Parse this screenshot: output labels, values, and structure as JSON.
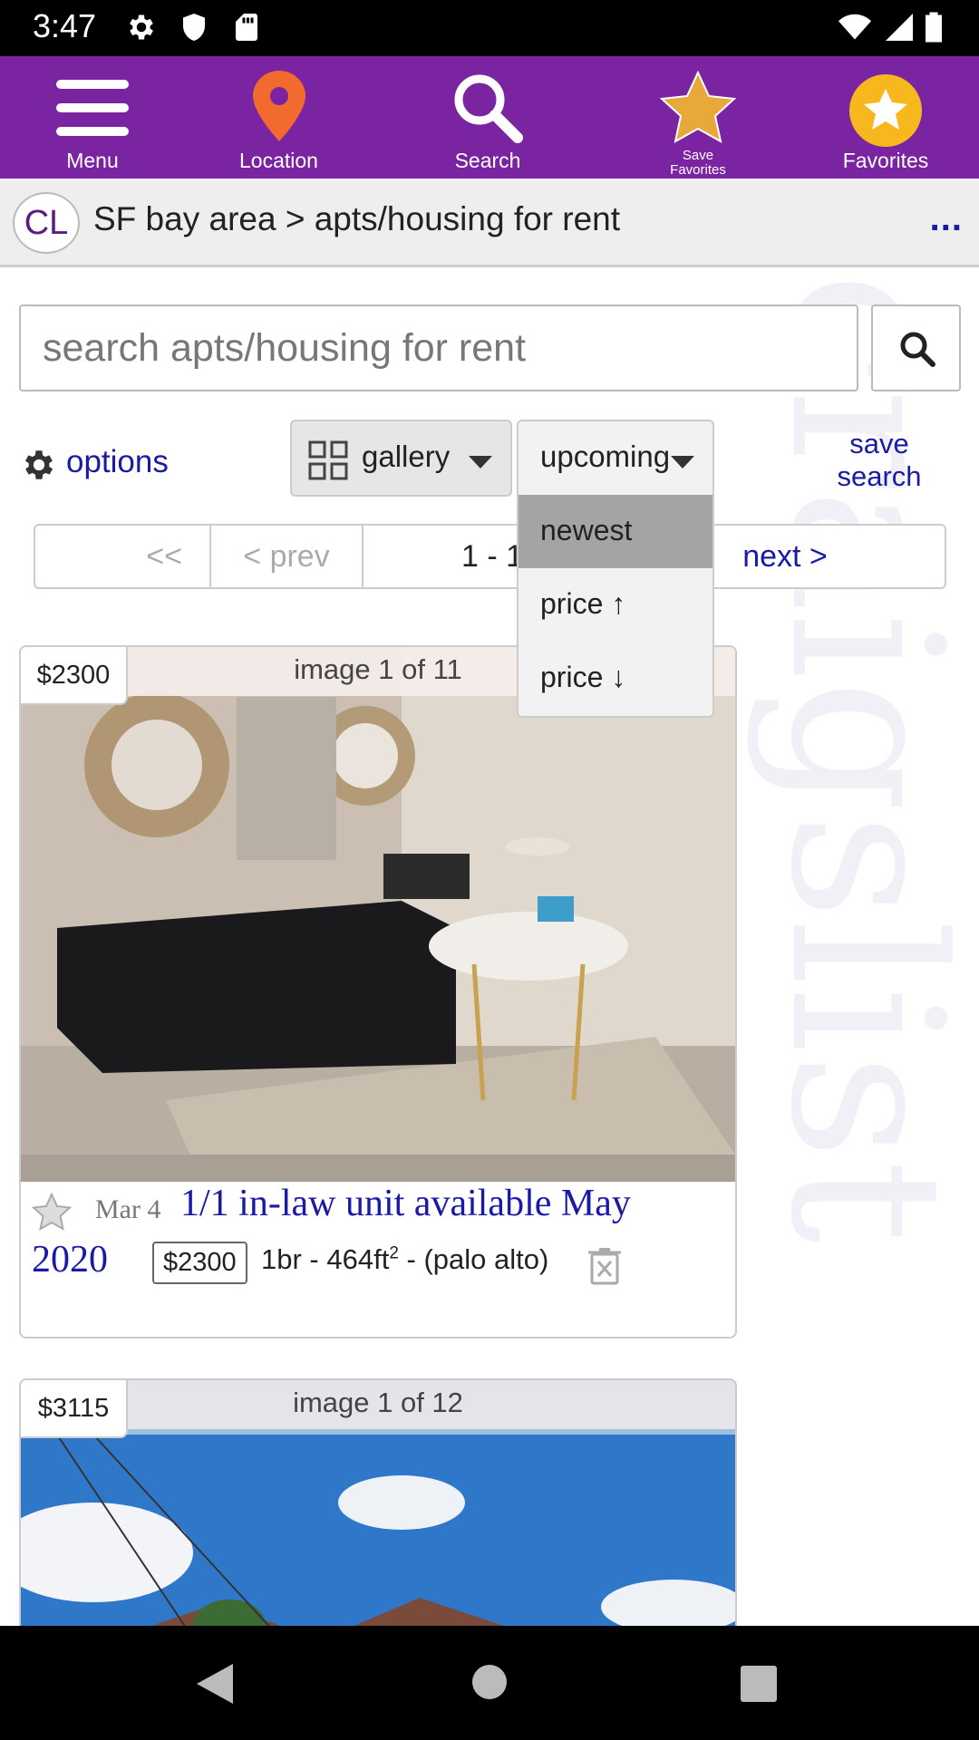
{
  "status_bar": {
    "time": "3:47",
    "left_icons": [
      "settings-gear-icon",
      "shield-icon",
      "sd-card-icon"
    ],
    "right_icons": [
      "wifi-icon",
      "cell-signal-icon",
      "battery-icon"
    ]
  },
  "toolbar": {
    "menu_label": "Menu",
    "location_label": "Location",
    "search_label": "Search",
    "save_favorites_line1": "Save",
    "save_favorites_line2": "Favorites",
    "favorites_label": "Favorites",
    "background": "#7b24a1",
    "location_pin_color": "#f26a2e",
    "star_color": "#e9a93a"
  },
  "breadcrumb": {
    "logo": "CL",
    "text": "SF bay area > apts/housing for rent",
    "more": "..."
  },
  "watermark": "craigslist",
  "search": {
    "placeholder": "search apts/housing for rent"
  },
  "controls": {
    "options_label": "options",
    "view_label": "gallery",
    "sort_selected": "upcoming",
    "sort_options": [
      "newest",
      "price ↑",
      "price ↓"
    ],
    "sort_highlighted": "newest",
    "save_search_line1": "save",
    "save_search_line2": "search"
  },
  "pager": {
    "first": "<<",
    "prev": "< prev",
    "range": "1 - 120",
    "next": "next >"
  },
  "listings": [
    {
      "price_badge": "$2300",
      "image_counter": "image 1 of 11",
      "date": "Mar 4",
      "title_line1": "1/1 in-law unit available May",
      "title_line2": "2020",
      "price": "$2300",
      "housing": "1br - 464ft",
      "housing_sup": "2",
      "location": " - (palo alto)"
    },
    {
      "price_badge": "$3115",
      "image_counter": "image 1 of 12"
    }
  ],
  "nav_bar": {
    "buttons": [
      "back-icon",
      "home-icon",
      "recents-icon"
    ]
  },
  "colors": {
    "link": "#1a1aa6",
    "accent": "#7b24a1"
  }
}
